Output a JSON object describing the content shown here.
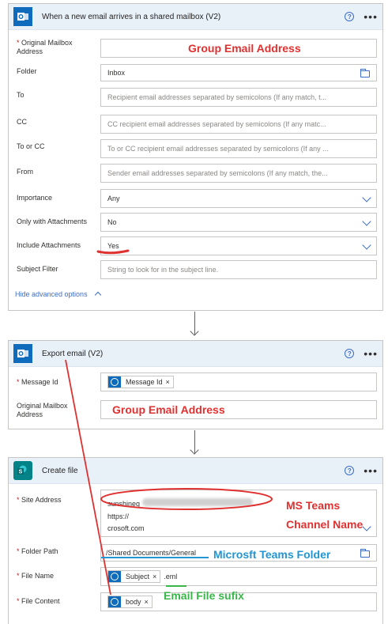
{
  "trigger": {
    "title": "When a new email arrives in a shared mailbox (V2)",
    "icon": "outlook-icon",
    "fields": {
      "original_mailbox": {
        "label_1": "Original Mailbox",
        "label_2": "Address",
        "value": ""
      },
      "folder": {
        "label": "Folder",
        "value": "Inbox"
      },
      "to": {
        "label": "To",
        "placeholder": "Recipient email addresses separated by semicolons (If any match, t..."
      },
      "cc": {
        "label": "CC",
        "placeholder": "CC recipient email addresses separated by semicolons (If any matc..."
      },
      "to_or_cc": {
        "label": "To or CC",
        "placeholder": "To or CC recipient email addresses separated by semicolons (If any ..."
      },
      "from": {
        "label": "From",
        "placeholder": "Sender email addresses separated by semicolons (If any match, the..."
      },
      "importance": {
        "label": "Importance",
        "value": "Any"
      },
      "only_attachments": {
        "label": "Only with Attachments",
        "value": "No"
      },
      "include_attachments": {
        "label": "Include Attachments",
        "value": "Yes"
      },
      "subject_filter": {
        "label": "Subject Filter",
        "placeholder": "String to look for in the subject line."
      }
    },
    "hide_advanced": "Hide advanced options"
  },
  "export": {
    "title": "Export email (V2)",
    "icon": "outlook-icon",
    "fields": {
      "message_id": {
        "label": "Message Id",
        "token": "Message Id"
      },
      "original_mailbox": {
        "label_1": "Original Mailbox",
        "label_2": "Address",
        "value": ""
      }
    }
  },
  "create_file": {
    "title": "Create file",
    "icon": "sharepoint-icon",
    "fields": {
      "site_address": {
        "label": "Site Address",
        "line1": "sunshineg",
        "line2": "https://",
        "line3": "crosoft.com"
      },
      "folder_path": {
        "label": "Folder Path",
        "value": "/Shared Documents/General"
      },
      "file_name": {
        "label": "File Name",
        "token": "Subject",
        "suffix": ".eml"
      },
      "file_content": {
        "label": "File Content",
        "token": "body"
      }
    }
  },
  "annotations": {
    "group_email_1": "Group Email Address",
    "group_email_2": "Group Email Address",
    "ms_teams_1": "MS Teams",
    "ms_teams_2": "Channel Name",
    "teams_folder": "Microsft Teams Folder",
    "email_suffix": "Email  File sufix"
  },
  "colors": {
    "accent": "#3b6dc8",
    "annotation_red": "#e03131",
    "annotation_blue": "#2196d3",
    "annotation_green": "#3ab54a",
    "header_bg": "#e8f0f8"
  }
}
